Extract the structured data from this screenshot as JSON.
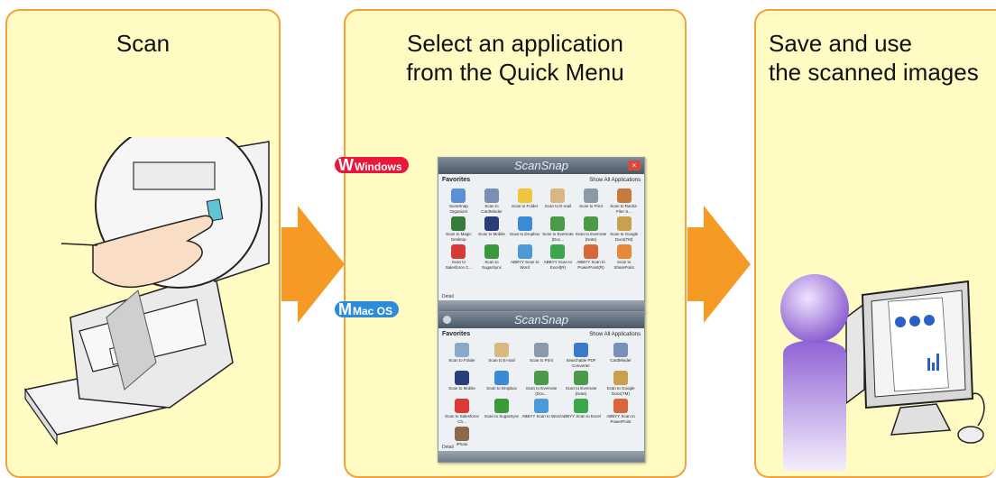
{
  "panels": [
    {
      "title": "Scan"
    },
    {
      "title": "Select an application\nfrom the Quick Menu"
    },
    {
      "title": "Save and use\nthe scanned images"
    }
  ],
  "os_labels": {
    "windows": "Windows",
    "mac": "Mac OS"
  },
  "windows_menu": {
    "title": "ScanSnap",
    "favorites": "Favorites",
    "show_all": "Show All Applications",
    "detail": "Detail",
    "items": [
      {
        "label": "ScanSnap Organizer",
        "color": "#5b8fd6"
      },
      {
        "label": "Scan to CardMinder",
        "color": "#7a8fb8"
      },
      {
        "label": "Scan to Folder",
        "color": "#f0c440"
      },
      {
        "label": "Scan to E-mail",
        "color": "#d8b880"
      },
      {
        "label": "Scan to Print",
        "color": "#8a9aa8"
      },
      {
        "label": "Scan to Rack2-Filer S...",
        "color": "#c87a3a"
      },
      {
        "label": "Scan to Magic Desktop",
        "color": "#3a7a3a"
      },
      {
        "label": "Scan to Mobile",
        "color": "#2a3f7a"
      },
      {
        "label": "Scan to Dropbox",
        "color": "#3a8ad8"
      },
      {
        "label": "Scan to Evernote (Doc...",
        "color": "#4a9a4a"
      },
      {
        "label": "Scan to Evernote (Note)",
        "color": "#4a9a4a"
      },
      {
        "label": "Scan to Google Docs(TM)",
        "color": "#c8a050"
      },
      {
        "label": "Scan to Salesforce C...",
        "color": "#d83a3a"
      },
      {
        "label": "Scan to SugarSync",
        "color": "#3a9a3a"
      },
      {
        "label": "ABBYY Scan to Word",
        "color": "#4a9ad8"
      },
      {
        "label": "ABBYY Scan to Excel(R)",
        "color": "#3aa84a"
      },
      {
        "label": "ABBYY Scan to PowerPoint(R)",
        "color": "#d8683a"
      },
      {
        "label": "Scan to SharePoint",
        "color": "#e8883a"
      }
    ]
  },
  "mac_menu": {
    "title": "ScanSnap",
    "favorites": "Favorites",
    "show_all": "Show All Applications",
    "detail": "Detail",
    "items": [
      {
        "label": "Scan to Folder",
        "color": "#8aa8c8"
      },
      {
        "label": "Scan to E-mail",
        "color": "#d8b880"
      },
      {
        "label": "Scan to Print",
        "color": "#8a9aa8"
      },
      {
        "label": "Searchable PDF Converter",
        "color": "#3a7ac8"
      },
      {
        "label": "CardMinder",
        "color": "#7a8fb8"
      },
      {
        "label": "Scan to Mobile",
        "color": "#2a3f7a"
      },
      {
        "label": "Scan to Dropbox",
        "color": "#3a8ad8"
      },
      {
        "label": "Scan to Evernote (Doc...",
        "color": "#4a9a4a"
      },
      {
        "label": "Scan to Evernote (Note)",
        "color": "#4a9a4a"
      },
      {
        "label": "Scan to Google Docs(TM)",
        "color": "#c8a050"
      },
      {
        "label": "Scan to Salesforce Ch...",
        "color": "#d83a3a"
      },
      {
        "label": "Scan to SugarSync",
        "color": "#3a9a3a"
      },
      {
        "label": "ABBYY Scan to Word",
        "color": "#4a9ad8"
      },
      {
        "label": "ABBYY Scan to Excel",
        "color": "#3aa84a"
      },
      {
        "label": "ABBYY Scan to PowerPoint",
        "color": "#d8683a"
      },
      {
        "label": "iPhoto",
        "color": "#8a6a4a"
      }
    ]
  },
  "colors": {
    "panel_bg": "#fffbc2",
    "panel_border": "#f2a23d",
    "arrow": "#f59a25"
  }
}
